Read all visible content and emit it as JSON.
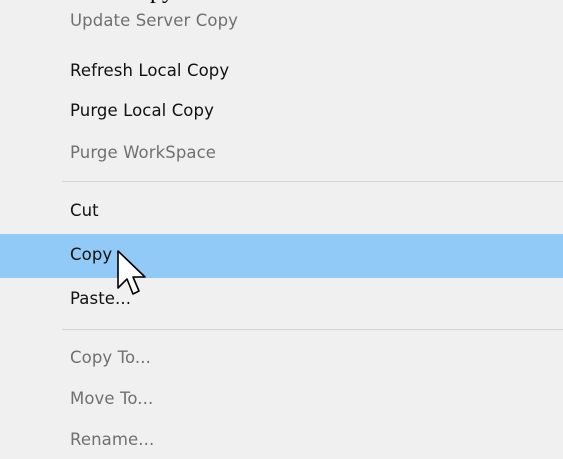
{
  "background_title_fragment": "py",
  "context_menu": {
    "groups": [
      {
        "items": [
          {
            "label": "Update Server Copy",
            "enabled": false,
            "highlighted": false
          },
          {
            "label": "Refresh Local Copy",
            "enabled": true,
            "highlighted": false
          },
          {
            "label": "Purge Local Copy",
            "enabled": true,
            "highlighted": false
          },
          {
            "label": "Purge WorkSpace",
            "enabled": false,
            "highlighted": false
          }
        ]
      },
      {
        "items": [
          {
            "label": "Cut",
            "enabled": true,
            "highlighted": false
          },
          {
            "label": "Copy",
            "enabled": true,
            "highlighted": true
          },
          {
            "label": "Paste...",
            "enabled": true,
            "highlighted": false
          }
        ]
      },
      {
        "items": [
          {
            "label": "Copy To...",
            "enabled": false,
            "highlighted": false
          },
          {
            "label": "Move To...",
            "enabled": false,
            "highlighted": false
          },
          {
            "label": "Rename...",
            "enabled": false,
            "highlighted": false
          }
        ]
      }
    ]
  },
  "colors": {
    "menu_background": "#f0f0f0",
    "highlight": "#91c9f7",
    "enabled_text": "#111111",
    "disabled_text": "#707070",
    "separator": "#d4d4d4"
  },
  "cursor": {
    "icon": "arrow-pointer-icon"
  }
}
